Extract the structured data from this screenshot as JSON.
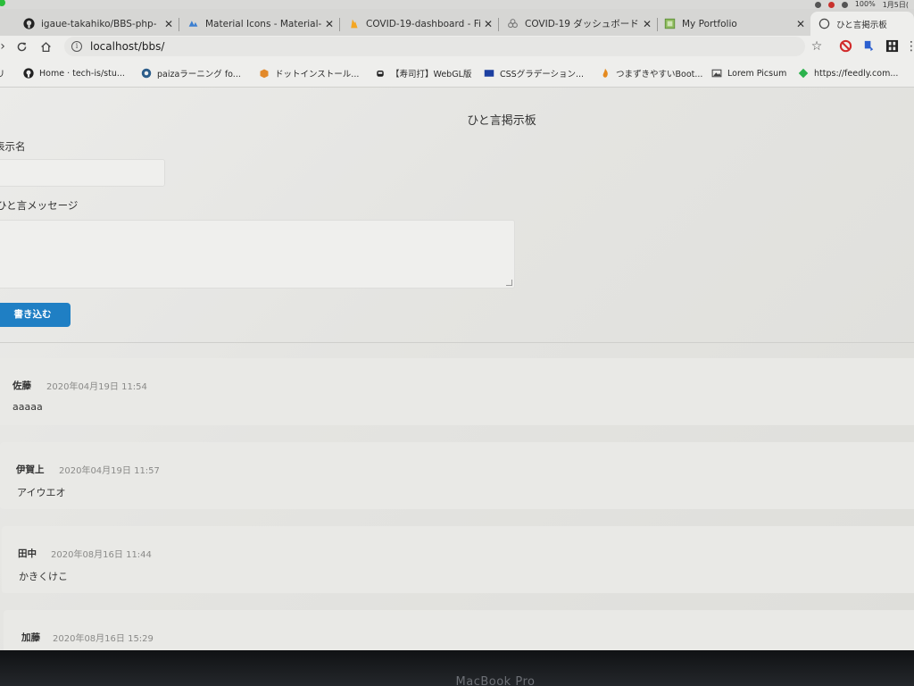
{
  "browser": {
    "tabs": [
      {
        "title": "igaue-takahiko/BBS-php-",
        "icon": "github-icon"
      },
      {
        "title": "Material Icons - Material-",
        "icon": "material-icon"
      },
      {
        "title": "COVID-19-dashboard - Fi",
        "icon": "firebase-icon"
      },
      {
        "title": "COVID-19 ダッシュボード",
        "icon": "covid-icon"
      },
      {
        "title": "My Portfolio",
        "icon": "portfolio-icon"
      },
      {
        "title": "ひと言掲示板",
        "icon": "globe-icon",
        "active": true
      }
    ],
    "url": "localhost/bbs/",
    "battery": "100%",
    "clock": "1月5日(",
    "bookmarks": [
      {
        "label": "リ",
        "icon": "apps-icon"
      },
      {
        "label": "Home · tech-is/stu...",
        "icon": "github-icon"
      },
      {
        "label": "paizaラーニング fo...",
        "icon": "paiza-icon"
      },
      {
        "label": "ドットインストール...",
        "icon": "box-icon"
      },
      {
        "label": "【寿司打】WebGL版",
        "icon": "sushi-icon"
      },
      {
        "label": "CSSグラデーション...",
        "icon": "css-icon"
      },
      {
        "label": "つまずきやすいBoot...",
        "icon": "flame-icon"
      },
      {
        "label": "Lorem Picsum",
        "icon": "image-icon"
      },
      {
        "label": "https://feedly.com...",
        "icon": "feedly-icon"
      }
    ]
  },
  "page": {
    "title": "ひと言掲示板",
    "name_label": "表示名",
    "message_label": "ひと言メッセージ",
    "submit_label": "書き込む",
    "name_value": "",
    "message_value": ""
  },
  "posts": [
    {
      "author": "佐藤",
      "date": "2020年04月19日 11:54",
      "message": "aaaaa"
    },
    {
      "author": "伊賀上",
      "date": "2020年04月19日 11:57",
      "message": "アイウエオ"
    },
    {
      "author": "田中",
      "date": "2020年08月16日 11:44",
      "message": "かきくけこ"
    },
    {
      "author": "加藤",
      "date": "2020年08月16日 15:29",
      "message": ""
    }
  ],
  "device_label": "MacBook Pro",
  "colors": {
    "button": "#1f7fc4",
    "page_bg": "#e6e6e3",
    "post_bg": "#e9e9e6"
  }
}
